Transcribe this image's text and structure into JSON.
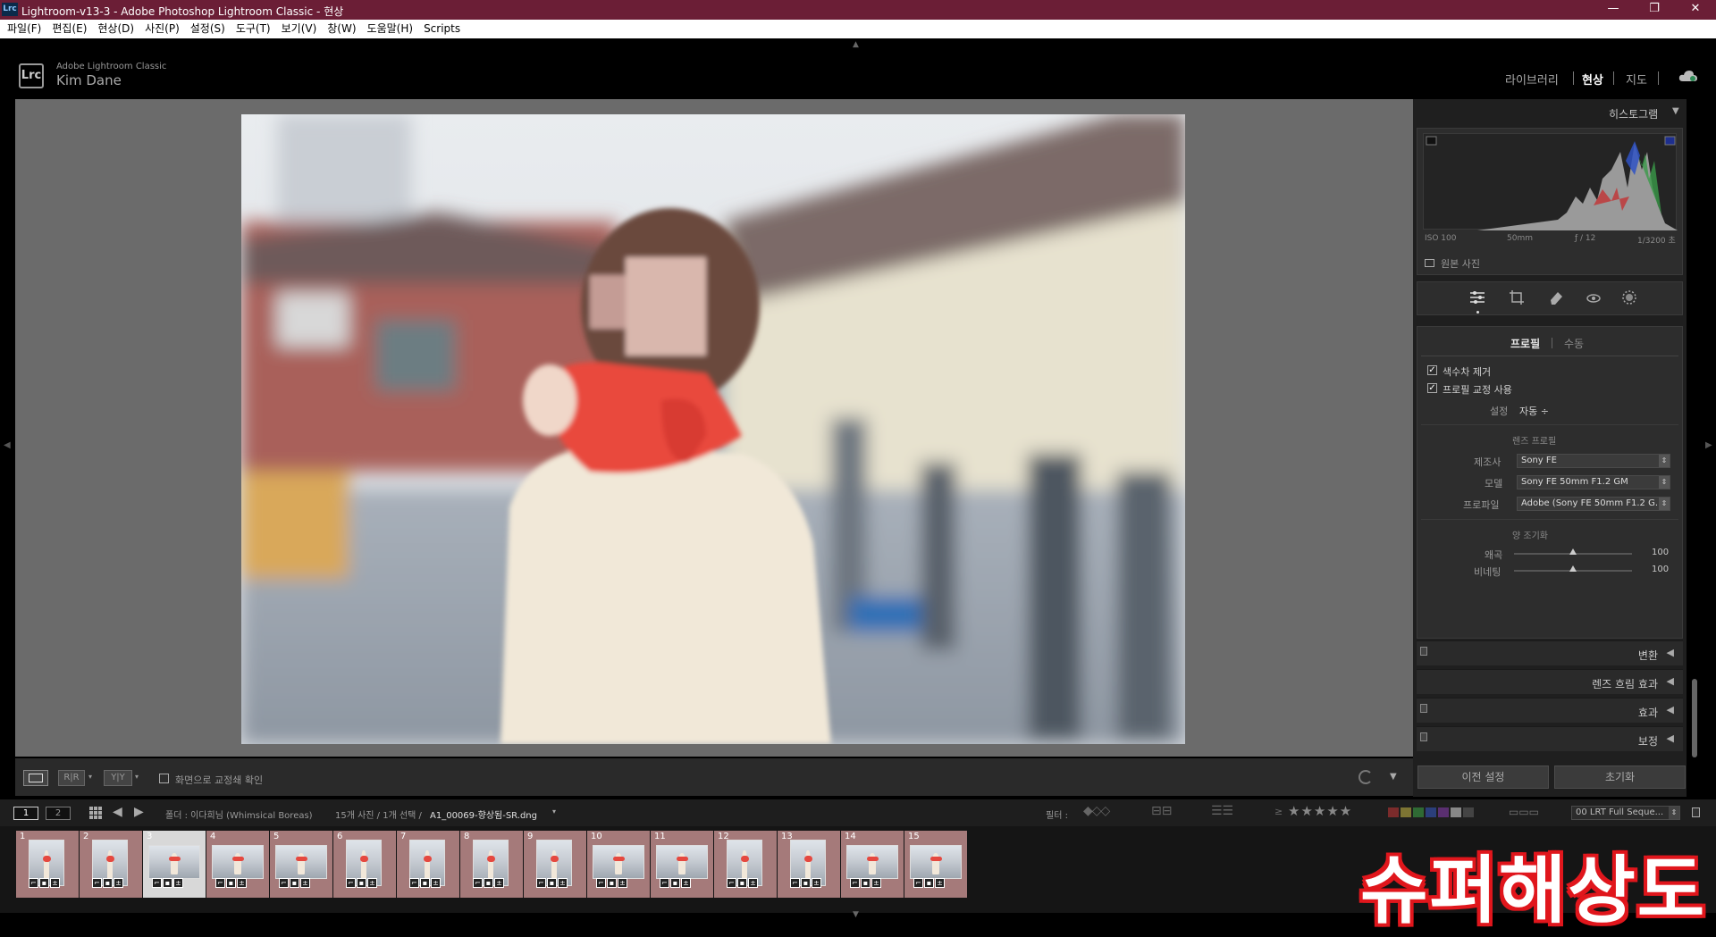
{
  "window": {
    "app_icon": "Lrc",
    "title": "Lightroom-v13-3 - Adobe Photoshop Lightroom Classic - 현상",
    "controls": [
      "—",
      "❐",
      "✕"
    ]
  },
  "menu": [
    "파일(F)",
    "편집(E)",
    "현상(D)",
    "사진(P)",
    "설정(S)",
    "도구(T)",
    "보기(V)",
    "창(W)",
    "도움말(H)",
    "Scripts"
  ],
  "identity": {
    "logo": "Lrc",
    "product": "Adobe Lightroom Classic",
    "user": "Kim Dane"
  },
  "modules": {
    "library": "라이브러리",
    "develop": "현상",
    "map": "지도"
  },
  "histogram": {
    "title": "히스토그램",
    "iso": "ISO 100",
    "focal": "50mm",
    "aperture": "ƒ / 12",
    "shutter": "1/3200 초",
    "original_label": "원본 사진"
  },
  "lens": {
    "tab_profile": "프로필",
    "tab_manual": "수동",
    "remove_ca": "색수차 제거",
    "enable_profile": "프로필 교정 사용",
    "setup_label": "설정",
    "setup_value": "자동 ÷",
    "lens_profile_header": "렌즈 프로필",
    "make_label": "제조사",
    "make_value": "Sony FE",
    "model_label": "모델",
    "model_value": "Sony FE 50mm F1.2 GM",
    "profile_label": "프로파일",
    "profile_value": "Adobe (Sony FE 50mm F1.2 G...",
    "amount_header": "양 조기화",
    "distortion_label": "왜곡",
    "distortion_value": "100",
    "distortion_level": 0.5,
    "vignetting_label": "비네팅",
    "vignetting_value": "100",
    "vignetting_level": 0.5
  },
  "panels": {
    "transform": "변환",
    "lens_blur": "렌즈 흐림 효과",
    "effects": "효과",
    "calibration": "보정"
  },
  "buttons": {
    "previous": "이전 설정",
    "reset": "초기화"
  },
  "toolbar": {
    "softproof": "화면으로 교정쇄 확인"
  },
  "filmstrip_bar": {
    "view1": "1",
    "view2": "2",
    "folder": "폴더 : 이다희님 (Whimsical Boreas)",
    "count": "15개 사진 / 1개 선택 /",
    "filename": "A1_00069-향상됨-SR.dng",
    "filter_label": "필터 :",
    "preset": "00 LRT Full Seque..."
  },
  "filmstrip": [
    "1",
    "2",
    "3",
    "4",
    "5",
    "6",
    "7",
    "8",
    "9",
    "10",
    "11",
    "12",
    "13",
    "14",
    "15"
  ],
  "watermark": "슈퍼해상도",
  "colors": {
    "titlebar": "#6b1e36",
    "panel": "#2d2d2d",
    "accent_red": "#e0161c"
  }
}
